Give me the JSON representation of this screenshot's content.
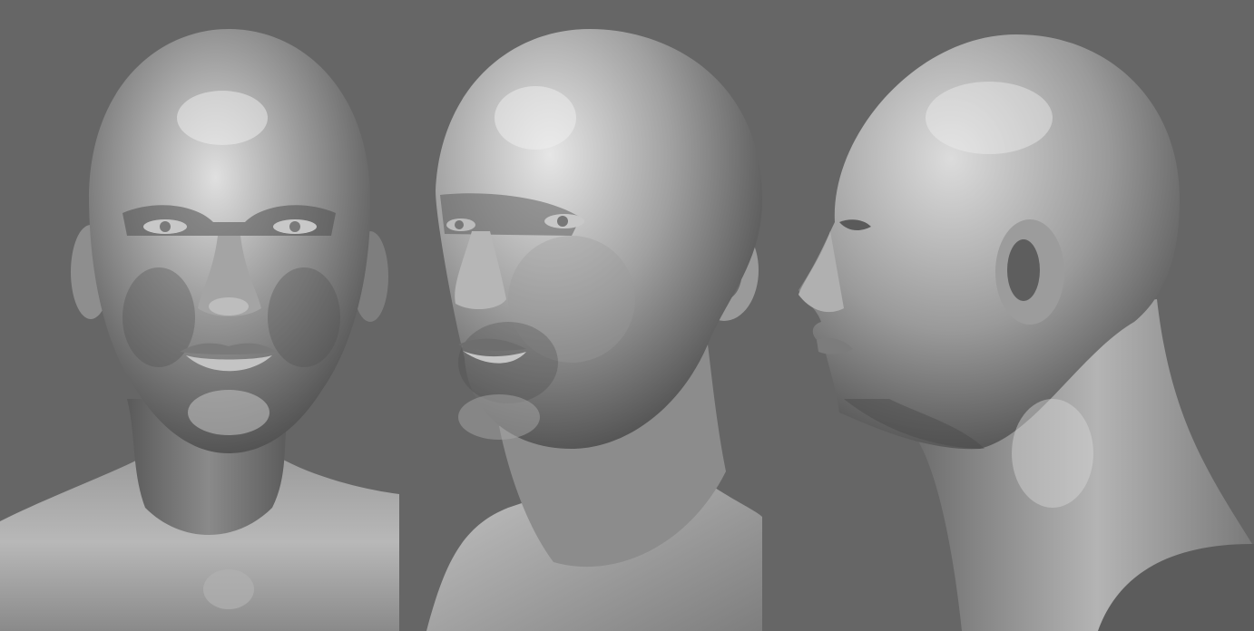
{
  "scene": {
    "background_color": "#666666",
    "clay_base_color": "#8c8c8c",
    "clay_highlight_color": "#e6e6e6",
    "clay_shadow_color": "#3a3a3a",
    "views": [
      {
        "id": "front",
        "description_icon": "head-front-view"
      },
      {
        "id": "three-quarter",
        "description_icon": "head-three-quarter-view"
      },
      {
        "id": "profile",
        "description_icon": "head-profile-view"
      }
    ]
  }
}
